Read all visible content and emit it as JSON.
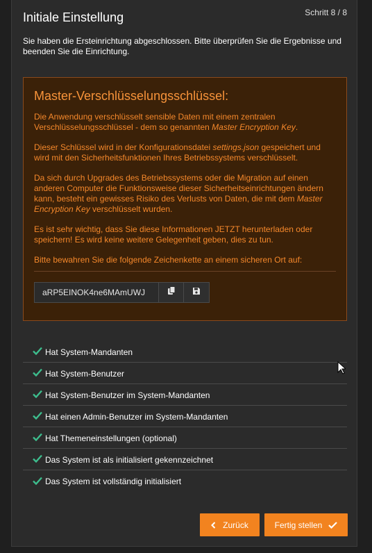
{
  "header": {
    "title": "Initiale Einstellung",
    "step": "Schritt 8 / 8"
  },
  "intro": "Sie haben die Ersteinrichtung abgeschlossen. Bitte überprüfen Sie die Ergebnisse und beenden Sie die Einrichtung.",
  "warning": {
    "heading": "Master-Verschlüsselungsschlüssel:",
    "p1_text": "Die Anwendung verschlüsselt sensible Daten mit einem zentralen Verschlüsselungsschlüssel - dem so genannten ",
    "p1_em": "Master Encryption Key",
    "p1_end": ".",
    "p2_text": "Dieser Schlüssel wird in der Konfigurationsdatei ",
    "p2_em": "settings.json",
    "p2_end": " gespeichert und wird mit den Sicherheitsfunktionen Ihres Betriebssystems verschlüsselt.",
    "p3_text": "Da sich durch Upgrades des Betriebssystems oder die Migration auf einen anderen Computer die Funktionsweise dieser Sicherheitseinrichtungen ändern kann, besteht ein gewisses Risiko des Verlusts von Daten, die mit dem ",
    "p3_em": "Master Encryption Key",
    "p3_end": " verschlüsselt wurden.",
    "p4": "Es ist sehr wichtig, dass Sie diese Informationen JETZT herunterladen oder speichern! Es wird keine weitere Gelegenheit geben, dies zu tun.",
    "p5": "Bitte bewahren Sie die folgende Zeichenkette an einem sicheren Ort auf:",
    "key_value": "aRP5EINOK4ne6MAmUWJ"
  },
  "checklist": [
    {
      "label": "Hat System-Mandanten"
    },
    {
      "label": "Hat System-Benutzer"
    },
    {
      "label": "Hat System-Benutzer im System-Mandanten"
    },
    {
      "label": "Hat einen Admin-Benutzer im System-Mandanten"
    },
    {
      "label": "Hat Themeneinstellungen (optional)"
    },
    {
      "label": "Das System ist als initialisiert gekennzeichnet"
    },
    {
      "label": "Das System ist vollständig initialisiert"
    }
  ],
  "buttons": {
    "back_label": "Zurück",
    "finish_label": "Fertig stellen"
  },
  "colors": {
    "accent": "#f2831f",
    "warning_bg": "#3b2108",
    "check": "#3dbd8d"
  },
  "icons": {
    "check": "check-icon",
    "copy": "copy-icon",
    "save": "save-icon",
    "back": "chevron-left-icon",
    "finish": "checkmark-icon"
  }
}
